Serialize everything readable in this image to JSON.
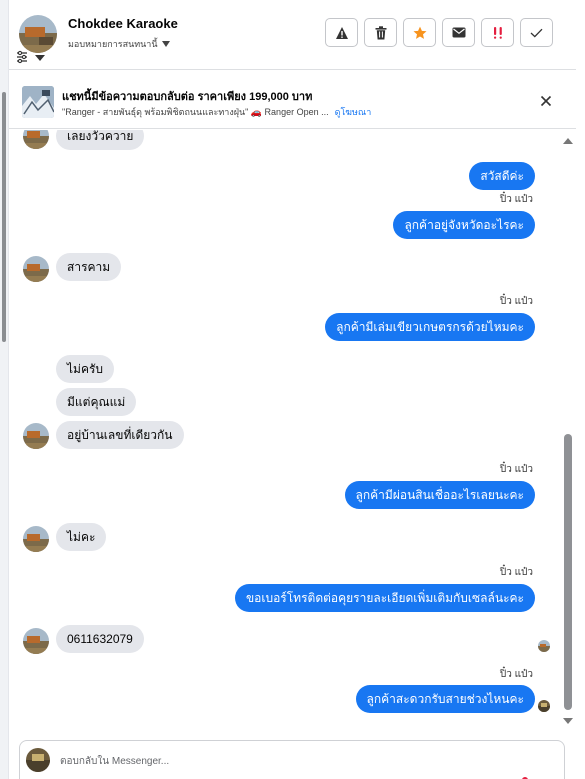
{
  "header": {
    "name": "Chokdee Karaoke",
    "assign_label": "มอบหมายการสนทนานี้",
    "actions": [
      {
        "icon": "warning-icon"
      },
      {
        "icon": "trash-icon"
      },
      {
        "icon": "star-icon",
        "color": "#f7931e"
      },
      {
        "icon": "mail-icon"
      },
      {
        "icon": "alert-double-icon",
        "color": "#e41e3f"
      },
      {
        "icon": "check-icon"
      }
    ]
  },
  "ad": {
    "title": "แชทนี้มีข้อความตอบกลับต่อ ราคาเพียง 199,000 บาท",
    "subtitle": "\"Ranger - สายพันธุ์ดุ พร้อมพิชิตถนนและทางฝุ่น\" 🚗 Ranger Open ...",
    "link": "ดูโฆษณา"
  },
  "messages": {
    "partial_top": "เลยงวัวควาย",
    "out_hello": "สวัสดีค่ะ",
    "sender_1": "ปิ๋ว แป๋ว",
    "out_province": "ลูกค้าอยู่จังหวัดอะไรคะ",
    "in_province": "สารคาม",
    "sender_2": "ปิ๋ว แป๋ว",
    "out_green_book": "ลูกค้ามีเล่มเขียวเกษตรกรด้วยไหมคะ",
    "in_no": "ไม่ครับ",
    "in_mother": "มีแต่คุณแม่",
    "in_same_house": "อยู่บ้านเลขที่เดียวกัน",
    "sender_3": "ปิ๋ว แป๋ว",
    "out_loan": "ลูกค้ามีผ่อนสินเชื่ออะไรเลยนะคะ",
    "in_no_ka": "ไม่คะ",
    "sender_4": "ปิ๋ว แป๋ว",
    "out_phone": "ขอเบอร์โทรติดต่อคุยรายละเอียดเพิ่มเติมกับเซลล์นะคะ",
    "in_phone": "0611632079",
    "sender_5": "ปิ๋ว แป๋ว",
    "out_call_time": "ลูกค้าสะดวกรับสายช่วงไหนคะ"
  },
  "composer": {
    "placeholder": "ตอบกลับใน Messenger..."
  },
  "colors": {
    "accent_blue": "#1877f2",
    "incoming_bubble": "#e4e6eb",
    "star_orange": "#f7931e",
    "alert_red": "#e41e3f"
  }
}
